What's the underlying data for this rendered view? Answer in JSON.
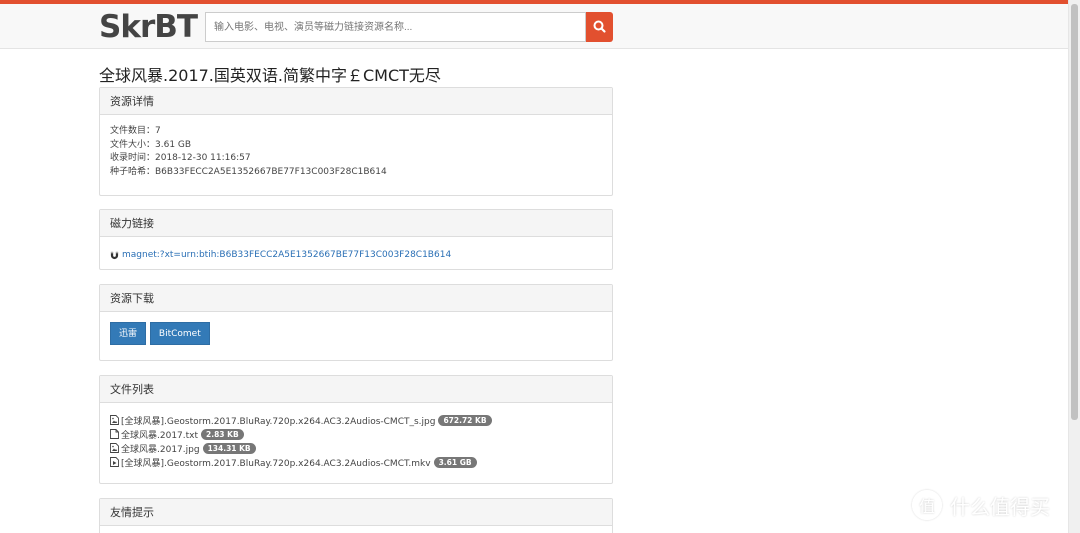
{
  "header": {
    "logo_text": "SkrBT",
    "search_placeholder": "输入电影、电视、演员等磁力链接资源名称..."
  },
  "page_title": "全球风暴.2017.国英双语.简繁中字￡CMCT无尽",
  "details": {
    "heading": "资源详情",
    "lines": [
      "文件数目：7",
      "文件大小：3.61 GB",
      "收录时间：2018-12-30 11:16:57",
      "种子哈希：B6B33FECC2A5E1352667BE77F13C003F28C1B614"
    ]
  },
  "magnet": {
    "heading": "磁力链接",
    "link": "magnet:?xt=urn:btih:B6B33FECC2A5E1352667BE77F13C003F28C1B614"
  },
  "download": {
    "heading": "资源下载",
    "buttons": [
      "迅雷",
      "BitComet"
    ]
  },
  "files": {
    "heading": "文件列表",
    "items": [
      {
        "name": "[全球风暴].Geostorm.2017.BluRay.720p.x264.AC3.2Audios-CMCT_s.jpg",
        "size": "672.72 KB",
        "icon": "image-file-icon"
      },
      {
        "name": "全球风暴.2017.txt",
        "size": "2.83 KB",
        "icon": "text-file-icon"
      },
      {
        "name": "全球风暴.2017.jpg",
        "size": "134.31 KB",
        "icon": "image-file-icon"
      },
      {
        "name": "[全球风暴].Geostorm.2017.BluRay.720p.x264.AC3.2Audios-CMCT.mkv",
        "size": "3.61 GB",
        "icon": "video-file-icon"
      }
    ]
  },
  "tips": {
    "heading": "友情提示"
  },
  "watermark": {
    "glyph": "值",
    "text": "什么值得买"
  },
  "colors": {
    "accent": "#e2502f",
    "button": "#337ab7",
    "link": "#2a6fb5"
  }
}
